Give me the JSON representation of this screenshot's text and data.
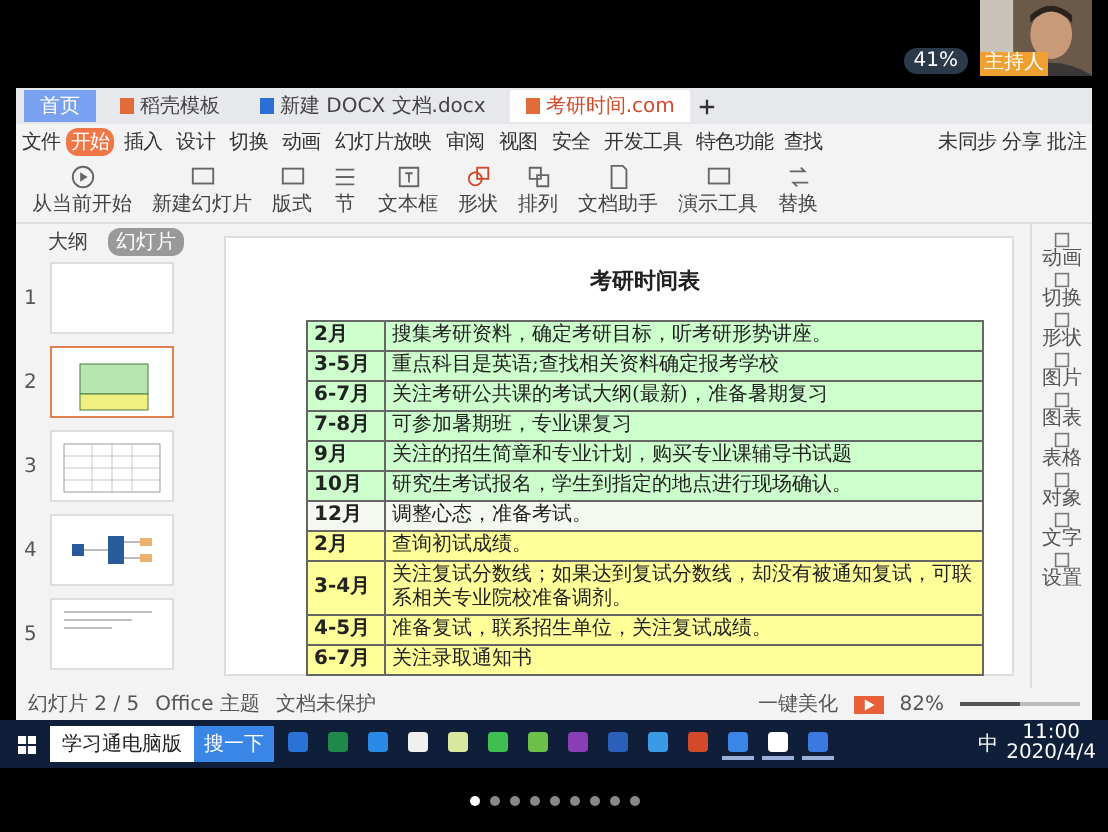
{
  "meeting": {
    "host_label": "主持人",
    "speed": "41%"
  },
  "doc_tabs": [
    {
      "label": "首页",
      "kind": "home",
      "selected": false
    },
    {
      "label": "稻壳模板",
      "kind": "doc",
      "selected": false
    },
    {
      "label": "新建 DOCX 文档.docx",
      "kind": "word",
      "selected": false
    },
    {
      "label": "考研时间.com",
      "kind": "ppt",
      "selected": true
    }
  ],
  "menu": {
    "file": "文件",
    "tabs": [
      {
        "label": "开始",
        "selected": true
      },
      {
        "label": "插入",
        "selected": false
      },
      {
        "label": "设计",
        "selected": false
      },
      {
        "label": "切换",
        "selected": false
      },
      {
        "label": "动画",
        "selected": false
      },
      {
        "label": "幻灯片放映",
        "selected": false
      },
      {
        "label": "审阅",
        "selected": false
      },
      {
        "label": "视图",
        "selected": false
      },
      {
        "label": "安全",
        "selected": false
      },
      {
        "label": "开发工具",
        "selected": false
      },
      {
        "label": "特色功能",
        "selected": false
      }
    ],
    "search": "查找",
    "right": [
      "未同步",
      "分享",
      "批注"
    ]
  },
  "ribbon": [
    {
      "label": "从当前开始",
      "kind": "play"
    },
    {
      "label": "新建幻灯片",
      "kind": "slide"
    },
    {
      "label": "版式",
      "kind": "layout"
    },
    {
      "label": "节",
      "kind": "section"
    },
    {
      "label": "文本框",
      "kind": "textbox"
    },
    {
      "label": "形状",
      "kind": "shape"
    },
    {
      "label": "排列",
      "kind": "arrange"
    },
    {
      "label": "文档助手",
      "kind": "doc"
    },
    {
      "label": "演示工具",
      "kind": "screen"
    },
    {
      "label": "替换",
      "kind": "replace"
    }
  ],
  "sidebar": {
    "tabs": [
      {
        "label": "大纲",
        "selected": false
      },
      {
        "label": "幻灯片",
        "selected": true
      }
    ],
    "slides": [
      {
        "number": "1",
        "kind": "blank",
        "selected": false
      },
      {
        "number": "2",
        "kind": "table",
        "selected": true
      },
      {
        "number": "3",
        "kind": "grid",
        "selected": false
      },
      {
        "number": "4",
        "kind": "diagram",
        "selected": false
      },
      {
        "number": "5",
        "kind": "text",
        "selected": false
      }
    ]
  },
  "slide": {
    "title": "考研时间表",
    "rows": [
      {
        "month": "2月",
        "text": "搜集考研资料，确定考研目标，听考研形势讲座。",
        "color": "#ccffcc"
      },
      {
        "month": "3-5月",
        "text": "重点科目是英语;查找相关资料确定报考学校",
        "color": "#ccffcc"
      },
      {
        "month": "6-7月",
        "text": "关注考研公共课的考试大纲(最新)，准备暑期复习",
        "color": "#ccffcc"
      },
      {
        "month": "7-8月",
        "text": "可参加暑期班，专业课复习",
        "color": "#ccffcc"
      },
      {
        "month": "9月",
        "text": "关注的招生简章和专业计划，购买专业课辅导书试题",
        "color": "#ccffcc"
      },
      {
        "month": "10月",
        "text": "研究生考试报名，学生到指定的地点进行现场确认。",
        "color": "#ccffcc"
      },
      {
        "month": "12月",
        "text": "调整心态，准备考试。",
        "color": "#f4f8f0"
      },
      {
        "month": "2月",
        "text": "查询初试成绩。",
        "color": "#ffff99"
      },
      {
        "month": "3-4月",
        "text": "关注复试分数线；如果达到复试分数线，却没有被通知复试，可联系相关专业院校准备调剂。",
        "color": "#ffff99"
      },
      {
        "month": "4-5月",
        "text": "准备复试，联系招生单位，关注复试成绩。",
        "color": "#ffff99"
      },
      {
        "month": "6-7月",
        "text": "关注录取通知书",
        "color": "#ffff99"
      }
    ]
  },
  "right_panel": [
    "动画",
    "切换",
    "形状",
    "图片",
    "图表",
    "表格",
    "对象",
    "文字",
    "设置"
  ],
  "status_bar": {
    "slide": "幻灯片 2 / 5",
    "theme": "Office 主题",
    "protect": "文档未保护",
    "beautify": "一键美化",
    "zoom": "82%",
    "zoom_slider": {
      "level": 0.5
    }
  },
  "taskbar": {
    "search": "学习通电脑版",
    "search_button": "搜一下",
    "apps": [
      {
        "kind": "outlook",
        "running": false
      },
      {
        "kind": "excel",
        "running": false
      },
      {
        "kind": "edge",
        "running": false
      },
      {
        "kind": "store",
        "running": false
      },
      {
        "kind": "photos",
        "running": false
      },
      {
        "kind": "green",
        "running": false
      },
      {
        "kind": "circle",
        "running": false
      },
      {
        "kind": "onenote",
        "running": false
      },
      {
        "kind": "word",
        "running": false
      },
      {
        "kind": "ie",
        "running": false
      },
      {
        "kind": "ppt",
        "running": false
      },
      {
        "kind": "wps",
        "running": true
      },
      {
        "kind": "wechat",
        "running": true
      },
      {
        "kind": "meeting",
        "running": true
      }
    ],
    "ime": "中",
    "time": "11:00",
    "date": "2020/4/4"
  },
  "pager": {
    "dots": [
      {
        "selected": true
      },
      {
        "selected": false
      },
      {
        "selected": false
      },
      {
        "selected": false
      },
      {
        "selected": false
      },
      {
        "selected": false
      },
      {
        "selected": false
      },
      {
        "selected": false
      },
      {
        "selected": false
      }
    ]
  }
}
